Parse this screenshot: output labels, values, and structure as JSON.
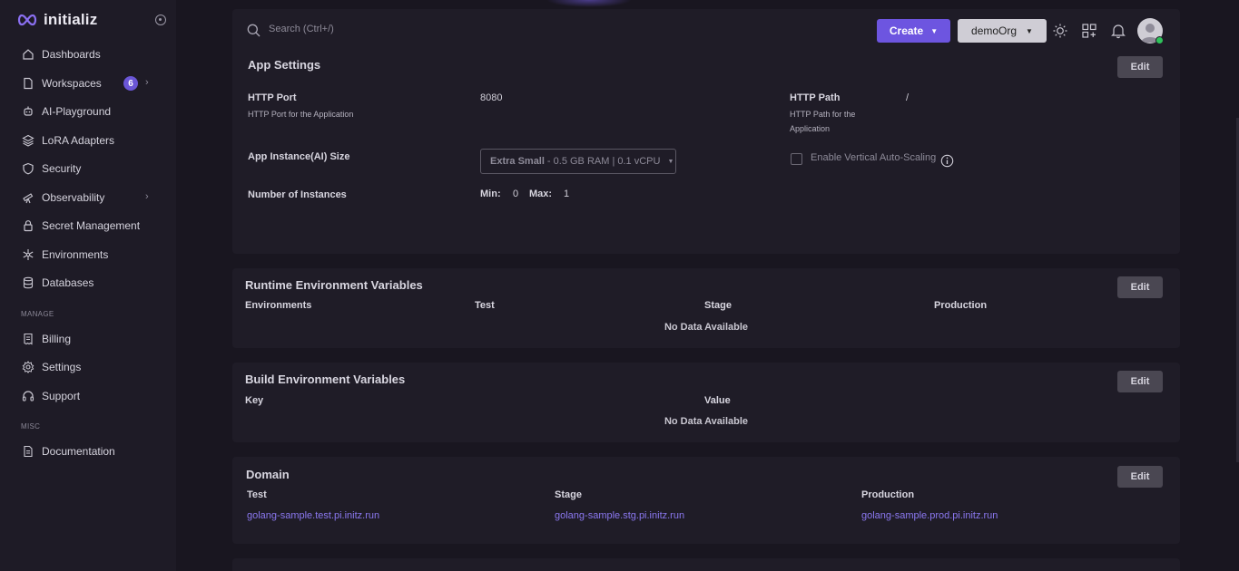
{
  "brand": {
    "name": "initializ"
  },
  "sidebar": {
    "items": [
      {
        "label": "Dashboards",
        "icon": "home-icon"
      },
      {
        "label": "Workspaces",
        "icon": "file-icon",
        "badge": "6"
      },
      {
        "label": "AI-Playground",
        "icon": "robot-icon"
      },
      {
        "label": "LoRA Adapters",
        "icon": "layers-icon"
      },
      {
        "label": "Security",
        "icon": "shield-icon"
      },
      {
        "label": "Observability",
        "icon": "telescope-icon"
      },
      {
        "label": "Secret Management",
        "icon": "lock-icon"
      },
      {
        "label": "Environments",
        "icon": "snowflake-icon"
      },
      {
        "label": "Databases",
        "icon": "database-icon"
      }
    ],
    "manage_label": "MANAGE",
    "manage_items": [
      {
        "label": "Billing",
        "icon": "receipt-icon"
      },
      {
        "label": "Settings",
        "icon": "gear-icon"
      },
      {
        "label": "Support",
        "icon": "headset-icon"
      }
    ],
    "misc_label": "MISC",
    "misc_items": [
      {
        "label": "Documentation",
        "icon": "document-icon"
      }
    ]
  },
  "topbar": {
    "search_placeholder": "Search (Ctrl+/)",
    "create_label": "Create",
    "org_label": "demoOrg"
  },
  "app_settings": {
    "title": "App Settings",
    "edit_label": "Edit",
    "http_port_label": "HTTP Port",
    "http_port_desc": "HTTP Port for the Application",
    "http_port_value": "8080",
    "http_path_label": "HTTP Path",
    "http_path_desc_1": "HTTP Path for the",
    "http_path_desc_2": "Application",
    "http_path_value": "/",
    "instance_size_label": "App Instance(AI) Size",
    "instance_size_name": "Extra Small",
    "instance_size_detail": "- 0.5 GB RAM | 0.1 vCPU",
    "autoscaling_label": "Enable Vertical Auto-Scaling",
    "instances_label": "Number of Instances",
    "min_label": "Min:",
    "min_value": "0",
    "max_label": "Max:",
    "max_value": "1"
  },
  "runtime_env": {
    "title": "Runtime Environment Variables",
    "edit_label": "Edit",
    "columns": [
      "Environments",
      "Test",
      "Stage",
      "Production"
    ],
    "empty": "No Data Available"
  },
  "build_env": {
    "title": "Build Environment Variables",
    "edit_label": "Edit",
    "columns": [
      "Key",
      "Value"
    ],
    "empty": "No Data Available"
  },
  "domain": {
    "title": "Domain",
    "edit_label": "Edit",
    "columns": [
      "Test",
      "Stage",
      "Production"
    ],
    "values": [
      "golang-sample.test.pi.initz.run",
      "golang-sample.stg.pi.initz.run",
      "golang-sample.prod.pi.initz.run"
    ]
  }
}
